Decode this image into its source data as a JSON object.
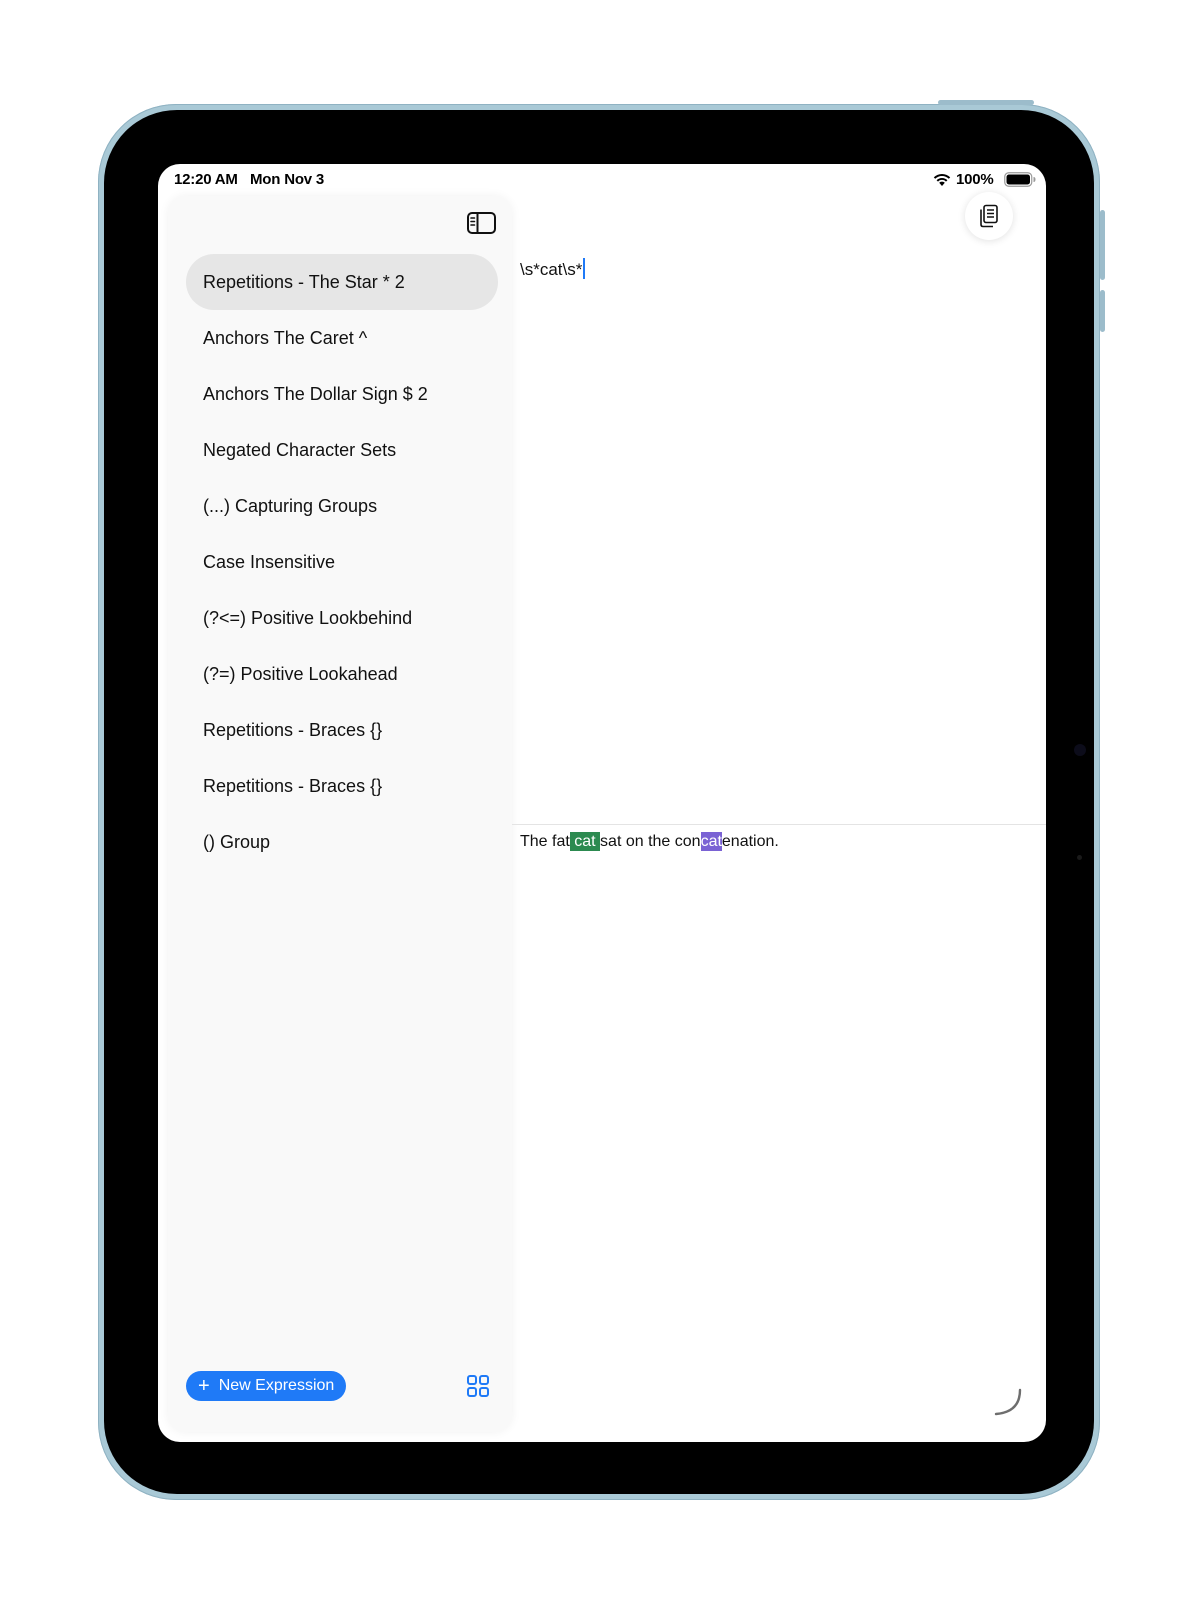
{
  "status_bar": {
    "time": "12:20 AM",
    "date": "Mon Nov 3",
    "battery_percent": "100%",
    "icons": [
      "wifi-icon",
      "battery-icon"
    ]
  },
  "sidebar": {
    "toggle_icon": "sidebar-toggle-icon",
    "items": [
      {
        "label": "Repetitions - The Star * 2",
        "selected": true
      },
      {
        "label": "Anchors The Caret ^",
        "selected": false
      },
      {
        "label": "Anchors The Dollar Sign $ 2",
        "selected": false
      },
      {
        "label": "Negated Character Sets",
        "selected": false
      },
      {
        "label": "(...) Capturing Groups",
        "selected": false
      },
      {
        "label": "Case Insensitive",
        "selected": false
      },
      {
        "label": "(?<=) Positive Lookbehind",
        "selected": false
      },
      {
        "label": "(?=) Positive Lookahead",
        "selected": false
      },
      {
        "label": "Repetitions - Braces {}",
        "selected": false
      },
      {
        "label": "Repetitions - Braces {}",
        "selected": false
      },
      {
        "label": "() Group",
        "selected": false
      }
    ],
    "new_expression_label": "New Expression",
    "grid_icon": "grid-icon"
  },
  "main": {
    "notes_icon": "notes-icon",
    "regex": "\\s*cat\\s*",
    "test_text": {
      "part1": "The fat",
      "match1": " cat ",
      "part2": "sat on the con",
      "match2": "cat",
      "part3": "enation."
    }
  },
  "colors": {
    "accent": "#1f7af7",
    "match_primary": "#2c8a50",
    "match_secondary": "#7a62d4",
    "selected_row": "#e6e6e6",
    "sidebar_bg": "#f9f9f9",
    "device_frame": "#a9c9d6"
  }
}
